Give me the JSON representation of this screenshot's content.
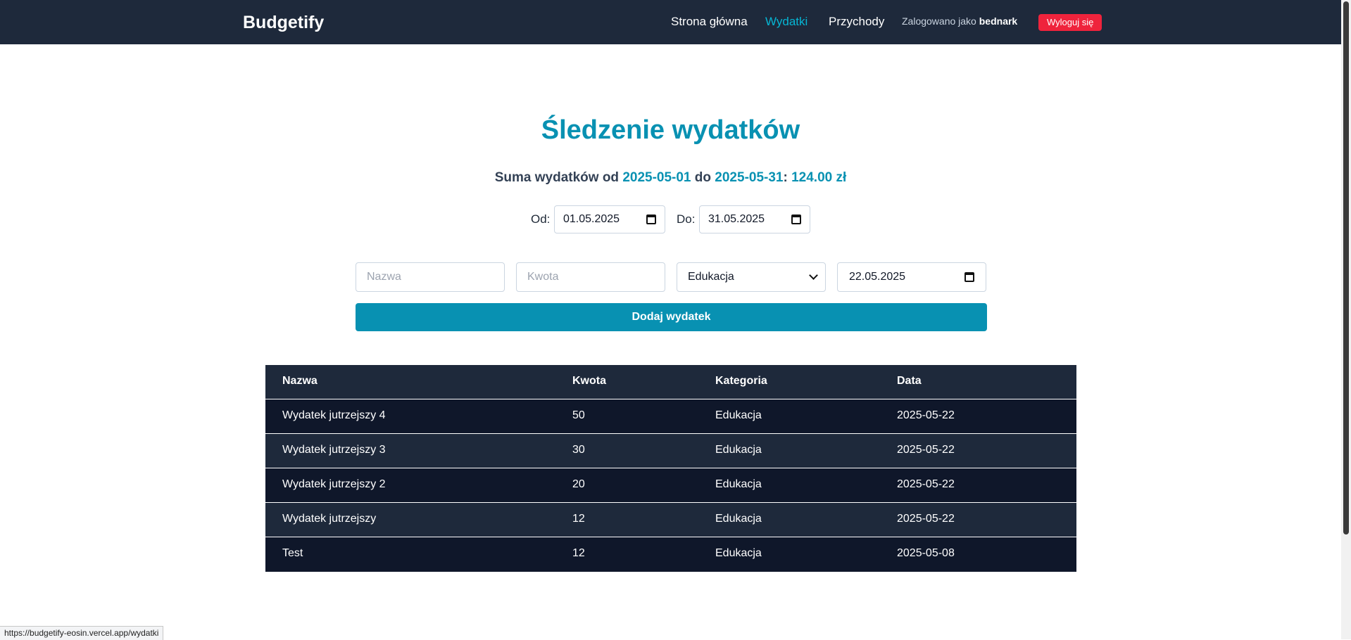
{
  "navbar": {
    "brand": "Budgetify",
    "links": [
      "Strona główna",
      "Wydatki",
      "Przychody"
    ],
    "login_prefix": "Zalogowano jako ",
    "username": "bednark",
    "logout_label": "Wyloguj się"
  },
  "page": {
    "title": "Śledzenie wydatków",
    "summary": {
      "prefix": "Suma wydatków od ",
      "from": "2025-05-01",
      "mid": " do ",
      "to": "2025-05-31",
      "colon": ": ",
      "total": "124.00 zł"
    }
  },
  "range": {
    "from_label": "Od:",
    "from_value": "01.05.2025",
    "to_label": "Do:",
    "to_value": "31.05.2025"
  },
  "form": {
    "name_placeholder": "Nazwa",
    "amount_placeholder": "Kwota",
    "category_value": "Edukacja",
    "date_value": "22.05.2025",
    "submit_label": "Dodaj wydatek"
  },
  "table": {
    "headers": [
      "Nazwa",
      "Kwota",
      "Kategoria",
      "Data"
    ],
    "rows": [
      [
        "Wydatek jutrzejszy 4",
        "50",
        "Edukacja",
        "2025-05-22"
      ],
      [
        "Wydatek jutrzejszy 3",
        "30",
        "Edukacja",
        "2025-05-22"
      ],
      [
        "Wydatek jutrzejszy 2",
        "20",
        "Edukacja",
        "2025-05-22"
      ],
      [
        "Wydatek jutrzejszy",
        "12",
        "Edukacja",
        "2025-05-22"
      ],
      [
        "Test",
        "12",
        "Edukacja",
        "2025-05-08"
      ]
    ]
  },
  "status_bar": {
    "url": "https://budgetify-eosin.vercel.app/wydatki"
  },
  "colors": {
    "navbar_bg": "#1e293b",
    "accent": "#0891b2",
    "logout_red": "#ef233c",
    "row_dark": "#0f172a",
    "row_light": "#1e293b"
  },
  "icons": [
    "calendar-icon",
    "chevron-down-icon"
  ]
}
